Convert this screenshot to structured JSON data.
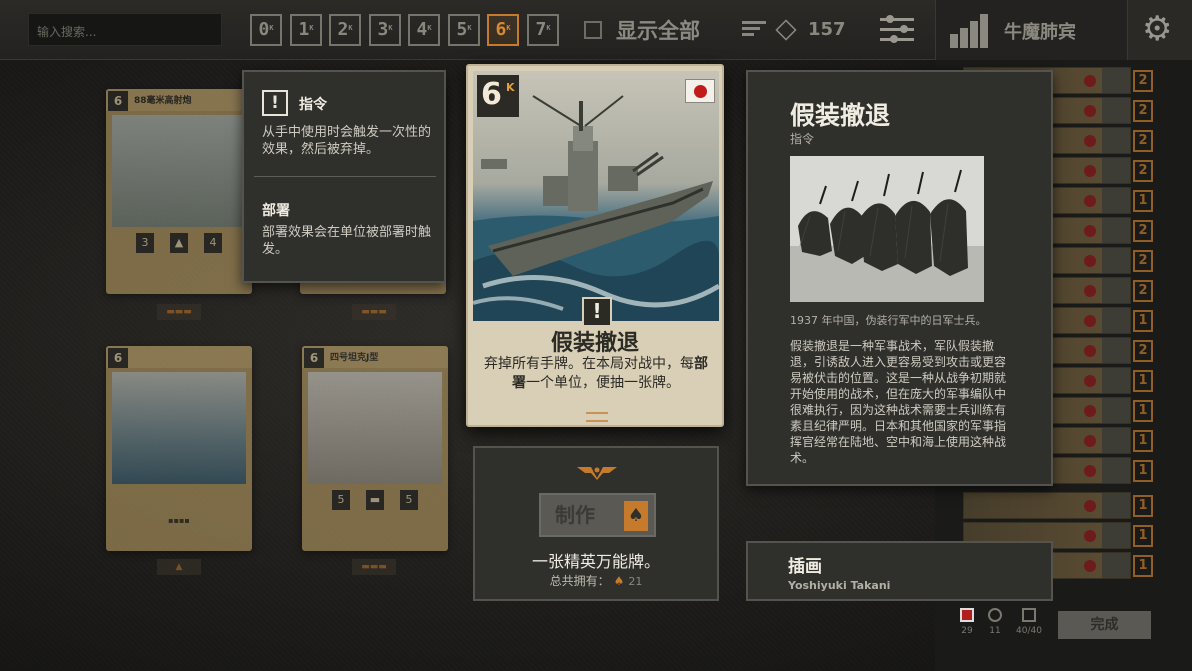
{
  "topbar": {
    "search_placeholder": "输入搜索...",
    "cost_filters": [
      "0",
      "1",
      "2",
      "3",
      "4",
      "5",
      "6",
      "7"
    ],
    "active_cost_filter": "6",
    "show_all_label": "显示全部",
    "credits": "157"
  },
  "deck": {
    "name": "牛魔肺宾",
    "counts": [
      "2",
      "2",
      "2",
      "2",
      "1",
      "2",
      "2",
      "2",
      "1",
      "2",
      "1",
      "1",
      "1",
      "1",
      "1",
      "1",
      "1",
      "1"
    ],
    "stat_values": [
      "29",
      "11",
      "40/40"
    ],
    "done_label": "完成"
  },
  "background_cards": [
    {
      "cost": "6",
      "name": "88毫米高射炮",
      "stats": [
        "3",
        "",
        "4"
      ]
    },
    {
      "cost": "6",
      "name": "",
      "stats": []
    },
    {
      "cost": "6",
      "name": "",
      "stats": []
    },
    {
      "cost": "6",
      "name": "四号坦克J型",
      "stats": [
        "5",
        "",
        "5"
      ]
    }
  ],
  "keyword_tooltip": {
    "icon": "exclamation-icon",
    "order_title": "指令",
    "order_desc": "从手中使用时会触发一次性的效果，然后被弃掉。",
    "deploy_title": "部署",
    "deploy_desc": "部署效果会在单位被部署时触发。"
  },
  "main_card": {
    "cost": "6",
    "cost_suffix": "K",
    "nation": "japan",
    "type_icon": "!",
    "title": "假装撤退",
    "text_part1": "弃掉所有手牌。在本局对战中，每",
    "text_bold": "部署",
    "text_part2": "一个单位，便抽一张牌。"
  },
  "craft": {
    "button_label": "制作",
    "description": "一张精英万能牌。",
    "owned_label": "总共拥有：",
    "owned_count": "21"
  },
  "info": {
    "title": "假装撤退",
    "subtitle": "指令",
    "caption": "1937 年中国，伪装行军中的日军士兵。",
    "body": "假装撤退是一种军事战术，军队假装撤退，引诱敌人进入更容易受到攻击或更容易被伏击的位置。这是一种从战争初期就开始使用的战术，但在庞大的军事编队中很难执行，因为这种战术需要士兵训练有素且纪律严明。日本和其他国家的军事指挥官经常在陆地、空中和海上使用这种战术。"
  },
  "illustration": {
    "title": "插画",
    "artist": "Yoshiyuki Takani"
  },
  "colors": {
    "accent": "#c57b2b",
    "panel": "#2f2f2c",
    "card": "#d9cfb6"
  }
}
